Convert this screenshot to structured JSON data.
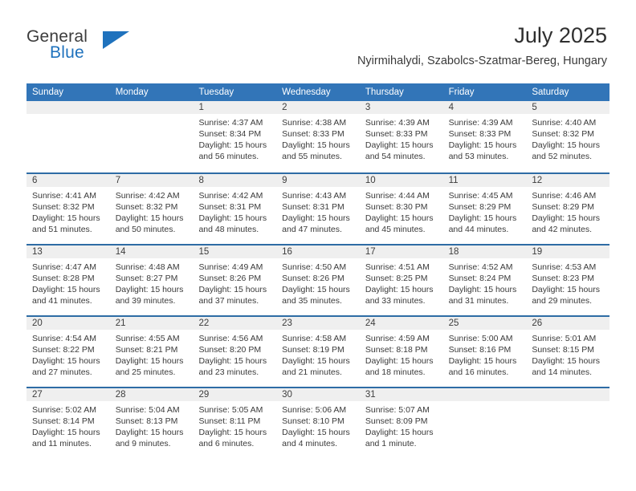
{
  "brand": {
    "name_part1": "General",
    "name_part2": "Blue",
    "flag_icon": "blue-flag-icon",
    "accent_color": "#1f72bd"
  },
  "header": {
    "title": "July 2025",
    "subtitle": "Nyirmihalydi, Szabolcs-Szatmar-Bereg, Hungary"
  },
  "colors": {
    "header_bar": "#3275b8",
    "week_divider": "#2e6ca5",
    "day_band": "#efefef",
    "text": "#3a3a3a"
  },
  "weekdays": [
    "Sunday",
    "Monday",
    "Tuesday",
    "Wednesday",
    "Thursday",
    "Friday",
    "Saturday"
  ],
  "weeks": [
    [
      {
        "day": "",
        "empty": true
      },
      {
        "day": "",
        "empty": true
      },
      {
        "day": "1",
        "sunrise": "Sunrise: 4:37 AM",
        "sunset": "Sunset: 8:34 PM",
        "daylight": "Daylight: 15 hours and 56 minutes."
      },
      {
        "day": "2",
        "sunrise": "Sunrise: 4:38 AM",
        "sunset": "Sunset: 8:33 PM",
        "daylight": "Daylight: 15 hours and 55 minutes."
      },
      {
        "day": "3",
        "sunrise": "Sunrise: 4:39 AM",
        "sunset": "Sunset: 8:33 PM",
        "daylight": "Daylight: 15 hours and 54 minutes."
      },
      {
        "day": "4",
        "sunrise": "Sunrise: 4:39 AM",
        "sunset": "Sunset: 8:33 PM",
        "daylight": "Daylight: 15 hours and 53 minutes."
      },
      {
        "day": "5",
        "sunrise": "Sunrise: 4:40 AM",
        "sunset": "Sunset: 8:32 PM",
        "daylight": "Daylight: 15 hours and 52 minutes."
      }
    ],
    [
      {
        "day": "6",
        "sunrise": "Sunrise: 4:41 AM",
        "sunset": "Sunset: 8:32 PM",
        "daylight": "Daylight: 15 hours and 51 minutes."
      },
      {
        "day": "7",
        "sunrise": "Sunrise: 4:42 AM",
        "sunset": "Sunset: 8:32 PM",
        "daylight": "Daylight: 15 hours and 50 minutes."
      },
      {
        "day": "8",
        "sunrise": "Sunrise: 4:42 AM",
        "sunset": "Sunset: 8:31 PM",
        "daylight": "Daylight: 15 hours and 48 minutes."
      },
      {
        "day": "9",
        "sunrise": "Sunrise: 4:43 AM",
        "sunset": "Sunset: 8:31 PM",
        "daylight": "Daylight: 15 hours and 47 minutes."
      },
      {
        "day": "10",
        "sunrise": "Sunrise: 4:44 AM",
        "sunset": "Sunset: 8:30 PM",
        "daylight": "Daylight: 15 hours and 45 minutes."
      },
      {
        "day": "11",
        "sunrise": "Sunrise: 4:45 AM",
        "sunset": "Sunset: 8:29 PM",
        "daylight": "Daylight: 15 hours and 44 minutes."
      },
      {
        "day": "12",
        "sunrise": "Sunrise: 4:46 AM",
        "sunset": "Sunset: 8:29 PM",
        "daylight": "Daylight: 15 hours and 42 minutes."
      }
    ],
    [
      {
        "day": "13",
        "sunrise": "Sunrise: 4:47 AM",
        "sunset": "Sunset: 8:28 PM",
        "daylight": "Daylight: 15 hours and 41 minutes."
      },
      {
        "day": "14",
        "sunrise": "Sunrise: 4:48 AM",
        "sunset": "Sunset: 8:27 PM",
        "daylight": "Daylight: 15 hours and 39 minutes."
      },
      {
        "day": "15",
        "sunrise": "Sunrise: 4:49 AM",
        "sunset": "Sunset: 8:26 PM",
        "daylight": "Daylight: 15 hours and 37 minutes."
      },
      {
        "day": "16",
        "sunrise": "Sunrise: 4:50 AM",
        "sunset": "Sunset: 8:26 PM",
        "daylight": "Daylight: 15 hours and 35 minutes."
      },
      {
        "day": "17",
        "sunrise": "Sunrise: 4:51 AM",
        "sunset": "Sunset: 8:25 PM",
        "daylight": "Daylight: 15 hours and 33 minutes."
      },
      {
        "day": "18",
        "sunrise": "Sunrise: 4:52 AM",
        "sunset": "Sunset: 8:24 PM",
        "daylight": "Daylight: 15 hours and 31 minutes."
      },
      {
        "day": "19",
        "sunrise": "Sunrise: 4:53 AM",
        "sunset": "Sunset: 8:23 PM",
        "daylight": "Daylight: 15 hours and 29 minutes."
      }
    ],
    [
      {
        "day": "20",
        "sunrise": "Sunrise: 4:54 AM",
        "sunset": "Sunset: 8:22 PM",
        "daylight": "Daylight: 15 hours and 27 minutes."
      },
      {
        "day": "21",
        "sunrise": "Sunrise: 4:55 AM",
        "sunset": "Sunset: 8:21 PM",
        "daylight": "Daylight: 15 hours and 25 minutes."
      },
      {
        "day": "22",
        "sunrise": "Sunrise: 4:56 AM",
        "sunset": "Sunset: 8:20 PM",
        "daylight": "Daylight: 15 hours and 23 minutes."
      },
      {
        "day": "23",
        "sunrise": "Sunrise: 4:58 AM",
        "sunset": "Sunset: 8:19 PM",
        "daylight": "Daylight: 15 hours and 21 minutes."
      },
      {
        "day": "24",
        "sunrise": "Sunrise: 4:59 AM",
        "sunset": "Sunset: 8:18 PM",
        "daylight": "Daylight: 15 hours and 18 minutes."
      },
      {
        "day": "25",
        "sunrise": "Sunrise: 5:00 AM",
        "sunset": "Sunset: 8:16 PM",
        "daylight": "Daylight: 15 hours and 16 minutes."
      },
      {
        "day": "26",
        "sunrise": "Sunrise: 5:01 AM",
        "sunset": "Sunset: 8:15 PM",
        "daylight": "Daylight: 15 hours and 14 minutes."
      }
    ],
    [
      {
        "day": "27",
        "sunrise": "Sunrise: 5:02 AM",
        "sunset": "Sunset: 8:14 PM",
        "daylight": "Daylight: 15 hours and 11 minutes."
      },
      {
        "day": "28",
        "sunrise": "Sunrise: 5:04 AM",
        "sunset": "Sunset: 8:13 PM",
        "daylight": "Daylight: 15 hours and 9 minutes."
      },
      {
        "day": "29",
        "sunrise": "Sunrise: 5:05 AM",
        "sunset": "Sunset: 8:11 PM",
        "daylight": "Daylight: 15 hours and 6 minutes."
      },
      {
        "day": "30",
        "sunrise": "Sunrise: 5:06 AM",
        "sunset": "Sunset: 8:10 PM",
        "daylight": "Daylight: 15 hours and 4 minutes."
      },
      {
        "day": "31",
        "sunrise": "Sunrise: 5:07 AM",
        "sunset": "Sunset: 8:09 PM",
        "daylight": "Daylight: 15 hours and 1 minute."
      },
      {
        "day": "",
        "empty": true
      },
      {
        "day": "",
        "empty": true
      }
    ]
  ]
}
